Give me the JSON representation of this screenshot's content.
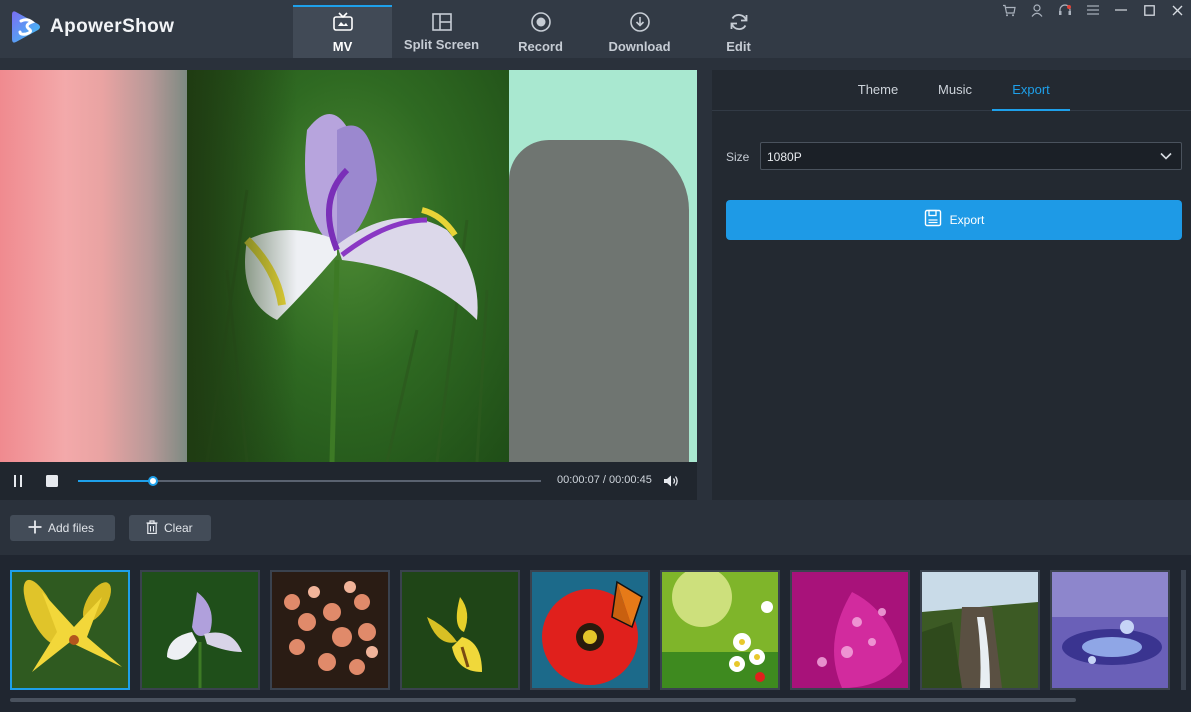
{
  "app": {
    "name": "ApowerShow"
  },
  "nav": {
    "tabs": [
      {
        "label": "MV",
        "icon": "tv-icon",
        "active": true
      },
      {
        "label": "Split Screen",
        "icon": "split-screen-icon",
        "active": false
      },
      {
        "label": "Record",
        "icon": "record-icon",
        "active": false
      },
      {
        "label": "Download",
        "icon": "download-icon",
        "active": false
      },
      {
        "label": "Edit",
        "icon": "refresh-icon",
        "active": false
      }
    ]
  },
  "window_controls": [
    "cart-icon",
    "user-icon",
    "support-icon",
    "menu-icon",
    "minimize-icon",
    "maximize-icon",
    "close-icon"
  ],
  "player": {
    "current_time": "00:00:07",
    "separator": "/",
    "total_time": "00:00:45",
    "progress": 0.163
  },
  "side_tabs": [
    {
      "label": "Theme",
      "active": false
    },
    {
      "label": "Music",
      "active": false
    },
    {
      "label": "Export",
      "active": true
    }
  ],
  "export": {
    "size_label": "Size",
    "size_value": "1080P",
    "button_label": "Export"
  },
  "toolbar": {
    "add_files": "Add files",
    "clear": "Clear"
  },
  "thumbnails": [
    {
      "name": "yellow-lily",
      "selected": true
    },
    {
      "name": "purple-iris",
      "selected": false
    },
    {
      "name": "pink-blossoms",
      "selected": false
    },
    {
      "name": "yellow-iris",
      "selected": false
    },
    {
      "name": "red-gerbera-butterfly",
      "selected": false
    },
    {
      "name": "daisies-sunlight",
      "selected": false
    },
    {
      "name": "magenta-petals-drops",
      "selected": false
    },
    {
      "name": "waterfall-forest",
      "selected": false
    },
    {
      "name": "water-droplets",
      "selected": false
    }
  ],
  "colors": {
    "accent": "#1ea0ea",
    "background": "#2a313b",
    "panel": "#232931"
  }
}
